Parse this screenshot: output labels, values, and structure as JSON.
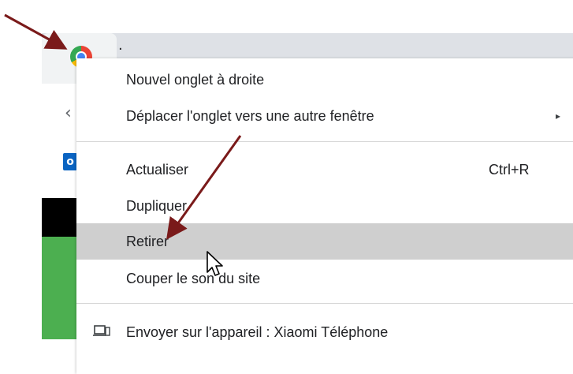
{
  "browser": {
    "tab_title_partial": "·"
  },
  "context_menu": {
    "items": [
      {
        "label": "Nouvel onglet à droite",
        "shortcut": "",
        "submenu": false
      },
      {
        "label": "Déplacer l'onglet vers une autre fenêtre",
        "shortcut": "",
        "submenu": true,
        "submenu_arrow": "▸"
      },
      {
        "label": "Actualiser",
        "shortcut": "Ctrl+R",
        "submenu": false
      },
      {
        "label": "Dupliquer",
        "shortcut": "",
        "submenu": false
      },
      {
        "label": "Retirer",
        "shortcut": "",
        "submenu": false,
        "highlighted": true
      },
      {
        "label": "Couper le son du site",
        "shortcut": "",
        "submenu": false
      },
      {
        "label": "Envoyer sur l'appareil : Xiaomi Téléphone",
        "shortcut": "",
        "submenu": false,
        "icon": "send-to-device-icon"
      }
    ]
  },
  "colors": {
    "highlight": "#cfcfcf",
    "annotation_arrow": "#7a1a1a",
    "green_panel": "#4caf50",
    "outlook_blue": "#0a64c2"
  },
  "icons": {
    "back": "back-arrow-icon",
    "outlook": "outlook-icon",
    "favicon": "site-favicon-icon",
    "cursor": "mouse-cursor-icon"
  },
  "glyphs": {
    "back_arrow": "‹",
    "outlook_letter": "o"
  }
}
